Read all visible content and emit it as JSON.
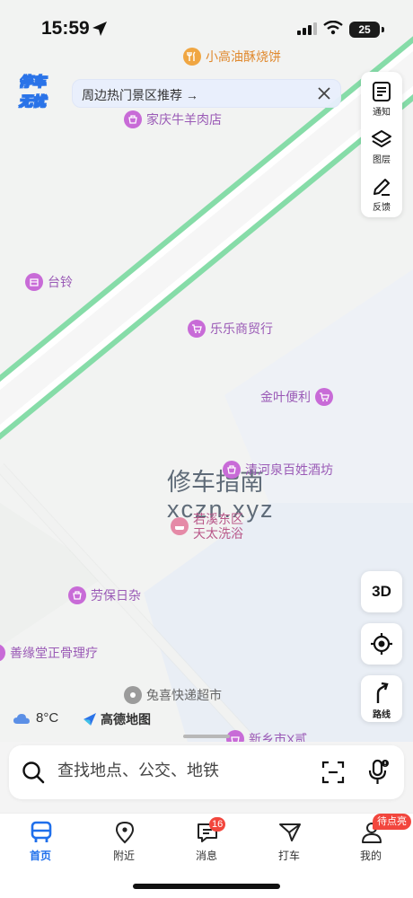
{
  "status_bar": {
    "time": "15:59",
    "battery": "25"
  },
  "app": {
    "logo_line1": "停车",
    "logo_line2": "无忧"
  },
  "banner": {
    "text": "周边热门景区推荐 →"
  },
  "map_pois": [
    {
      "label": "小高油酥烧饼",
      "style": "orange"
    },
    {
      "label": "家庆牛羊肉店",
      "style": "purple"
    },
    {
      "label": "台铃",
      "style": "purple"
    },
    {
      "label": "乐乐商贸行",
      "style": "purple"
    },
    {
      "label": "金叶便利",
      "style": "purple"
    },
    {
      "label": "清河泉百姓酒坊",
      "style": "purple"
    },
    {
      "label": "若溪东区\n天太洗浴",
      "style": "pink"
    },
    {
      "label": "劳保日杂",
      "style": "purple"
    },
    {
      "label": "善缘堂正骨理疗",
      "style": "purple"
    },
    {
      "label": "兔喜快递超市",
      "style": "gray"
    },
    {
      "label": "新乡市X贰",
      "style": "purple"
    }
  ],
  "watermark": {
    "line1": "修车指南",
    "line2": "xczn.xyz"
  },
  "tools": [
    {
      "label": "通知",
      "icon": "notice-icon"
    },
    {
      "label": "图层",
      "icon": "layers-icon"
    },
    {
      "label": "反馈",
      "icon": "feedback-icon"
    }
  ],
  "map_controls": {
    "three_d": "3D",
    "route_label": "路线"
  },
  "weather": {
    "temperature": "8°C",
    "icon": "cloud-icon"
  },
  "map_brand": {
    "name": "高德地图"
  },
  "search": {
    "placeholder": "查找地点、公交、地铁"
  },
  "tabs": [
    {
      "label": "首页",
      "icon": "bus-icon",
      "active": true
    },
    {
      "label": "附近",
      "icon": "location-pin-icon"
    },
    {
      "label": "消息",
      "icon": "message-icon",
      "badge": "16"
    },
    {
      "label": "打车",
      "icon": "taxi-icon"
    },
    {
      "label": "我的",
      "icon": "user-icon",
      "badge": "待点亮"
    }
  ],
  "colors": {
    "accent": "#1f6feb",
    "road_green": "#7fd9a4",
    "badge_red": "#f2463d",
    "poi_purple": "#c86bd7"
  }
}
